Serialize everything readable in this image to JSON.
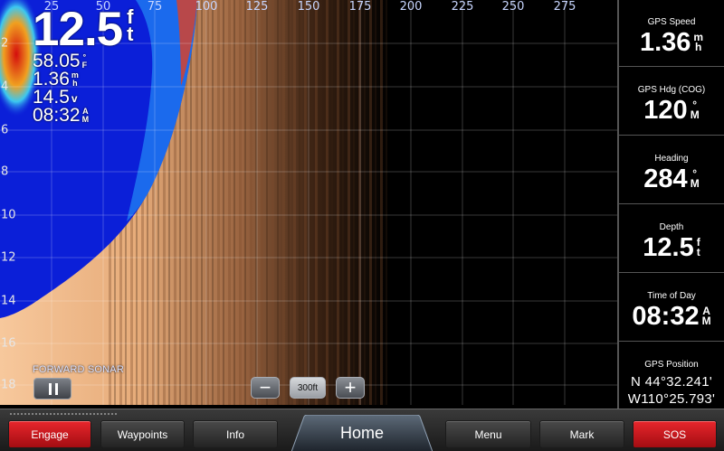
{
  "sonar": {
    "x_ticks": [
      "25",
      "50",
      "75",
      "100",
      "125",
      "150",
      "175",
      "200",
      "225",
      "250",
      "275"
    ],
    "y_ticks": [
      "2",
      "4",
      "6",
      "8",
      "10",
      "12",
      "14",
      "16",
      "18"
    ],
    "mode_label": "FORWARD SONAR",
    "colors": {
      "water": "#0b1fd8",
      "bottom": "#f6c69a",
      "dark": "#2a160c",
      "hot": "#e01010"
    }
  },
  "overlay": {
    "depth": {
      "value": "12.5",
      "unit": [
        "f",
        "t"
      ]
    },
    "temperature": {
      "value": "58.05",
      "unit": [
        "°",
        "F"
      ]
    },
    "speed": {
      "value": "1.36",
      "unit": [
        "m",
        "h"
      ]
    },
    "voltage": {
      "value": "14.5",
      "unit": "v"
    },
    "time": {
      "value": "08:32",
      "unit": [
        "A",
        "M"
      ]
    }
  },
  "zoom": {
    "minus": "−",
    "level": "300ft",
    "plus": "+"
  },
  "panel": {
    "gps_speed": {
      "label": "GPS Speed",
      "value": "1.36",
      "unit": [
        "m",
        "h"
      ]
    },
    "gps_heading": {
      "label": "GPS Hdg (COG)",
      "value": "120",
      "unit": [
        "°",
        "M"
      ]
    },
    "heading": {
      "label": "Heading",
      "value": "284",
      "unit": [
        "°",
        "M"
      ]
    },
    "depth": {
      "label": "Depth",
      "value": "12.5",
      "unit": [
        "f",
        "t"
      ]
    },
    "time_of_day": {
      "label": "Time of Day",
      "value": "08:32",
      "unit": [
        "A",
        "M"
      ]
    },
    "gps_position": {
      "label": "GPS Position",
      "lat": "N  44°32.241'",
      "lon": "W110°25.793'"
    }
  },
  "bottombar": {
    "engage": "Engage",
    "waypoints": "Waypoints",
    "info": "Info",
    "home": "Home",
    "menu": "Menu",
    "mark": "Mark",
    "sos": "SOS"
  }
}
